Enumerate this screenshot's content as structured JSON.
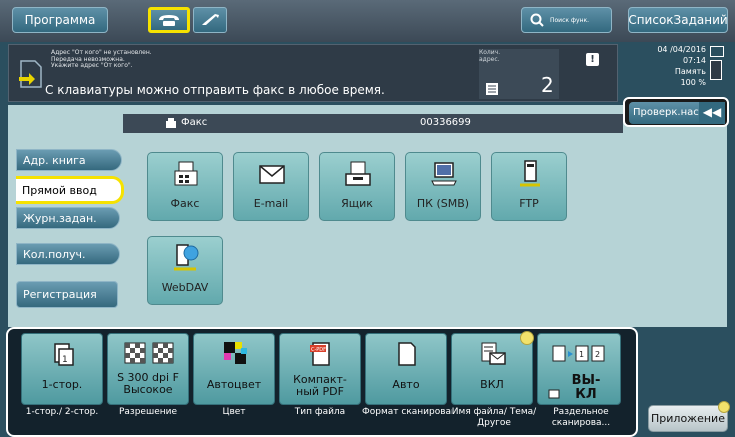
{
  "topbar": {
    "program_label": "Программа",
    "search_label": "Поиск функ.",
    "job_list_label": "СписокЗаданий"
  },
  "message": {
    "small_lines": "Адрес \"От кого\" не установлен.\nПередача невозможна.\nУкажите адрес \"От кого\".",
    "main_text": "С клавиатуры можно отправить факс в любое время."
  },
  "counter": {
    "label": "Колич. адрес.",
    "value": "2"
  },
  "status": {
    "date": "04 /04/2016",
    "time": "07:14",
    "memory_label": "Память",
    "memory_value": "100 %"
  },
  "check_button_label": "Проверк.настр.",
  "destination": {
    "type": "Факс",
    "number": "00336699"
  },
  "left_tabs": [
    {
      "label": "Адр. книга"
    },
    {
      "label": "Прямой ввод",
      "active": true
    },
    {
      "label": "Журн.задан."
    },
    {
      "label": "Кол.получ."
    }
  ],
  "registration_label": "Регистрация",
  "tiles": [
    {
      "label": "Факс",
      "icon": "fax-icon"
    },
    {
      "label": "E-mail",
      "icon": "envelope-icon"
    },
    {
      "label": "Ящик",
      "icon": "box-icon"
    },
    {
      "label": "ПК (SMB)",
      "icon": "computer-icon"
    },
    {
      "label": "FTP",
      "icon": "ftp-icon"
    },
    {
      "label": "WebDAV",
      "icon": "webdav-icon"
    }
  ],
  "settings": [
    {
      "value": "1-стор.",
      "label": "1-стор./ 2-стор."
    },
    {
      "value": "S 300 dpi F Высокое",
      "label": "Разрешение"
    },
    {
      "value": "Автоцвет",
      "label": "Цвет"
    },
    {
      "value": "Компакт- ный PDF",
      "label": "Тип файла"
    },
    {
      "value": "Авто",
      "label": "Формат сканировани"
    },
    {
      "value": "ВКЛ",
      "label": "Имя файла/ Тема/Другое"
    },
    {
      "value": "ВЫ- КЛ",
      "label": "Раздельное сканирова..."
    }
  ],
  "app_button_label": "Приложение",
  "colors": {
    "accent_yellow": "#f6e200",
    "button_blue": "#33697f",
    "tile_teal": "#62a9ad",
    "panel_bg": "#b6d3d6"
  }
}
